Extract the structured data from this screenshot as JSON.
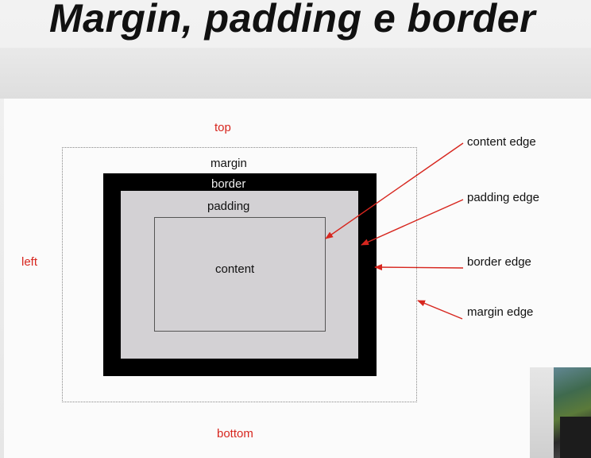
{
  "slide": {
    "title": "Margin, padding e border"
  },
  "diagram": {
    "side_labels": {
      "top": "top",
      "left": "left",
      "bottom": "bottom"
    },
    "box_labels": {
      "margin": "margin",
      "border": "border",
      "padding": "padding",
      "content": "content"
    },
    "edge_labels": {
      "content_edge": "content edge",
      "padding_edge": "padding edge",
      "border_edge": "border edge",
      "margin_edge": "margin edge"
    },
    "colors": {
      "annotation": "#d7261e",
      "border": "#000000",
      "padding": "#d3d1d4"
    }
  }
}
